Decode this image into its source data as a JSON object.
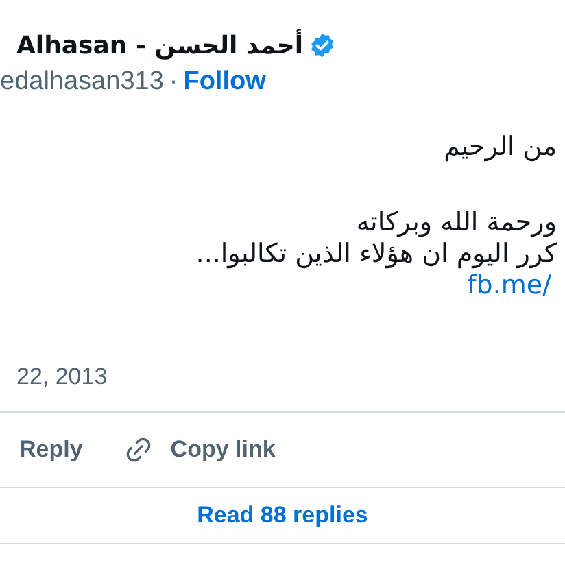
{
  "author": {
    "name": "Alhasan - أحمد الحسن",
    "verified": true,
    "handle": "edalhasan313",
    "separator": "·",
    "follow": "Follow"
  },
  "tweet": {
    "lines": [
      {
        "text": "من الرحيم",
        "kind": "text"
      },
      {
        "text": "ورحمة الله وبركاته",
        "kind": "text"
      },
      {
        "text": "كرر اليوم ان هؤلاء الذين تكالبوا...",
        "kind": "text"
      },
      {
        "text": "fb.me/",
        "kind": "link"
      }
    ],
    "date": "22, 2013"
  },
  "reply_button": "Reply",
  "copy_link_button": "Copy link",
  "read_replies": "Read 88 replies"
}
